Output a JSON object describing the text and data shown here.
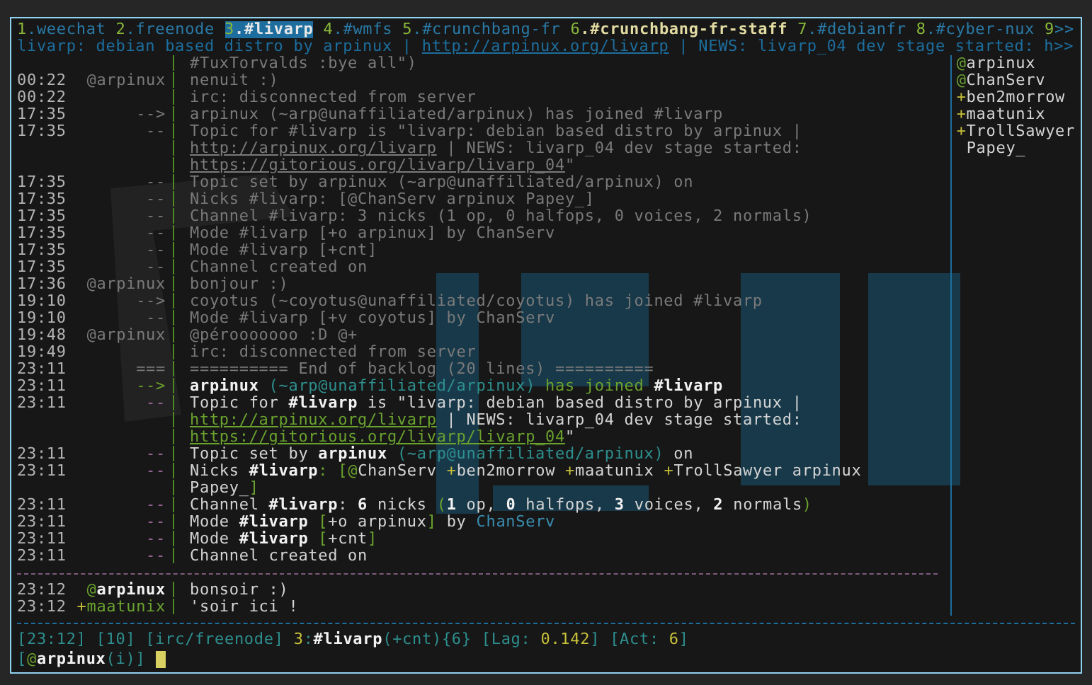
{
  "tabs": [
    {
      "number": "1",
      "name": ".weechat",
      "selected": false,
      "highlight": false
    },
    {
      "number": "2",
      "name": ".freenode",
      "selected": false,
      "highlight": false
    },
    {
      "number": "3",
      "name": ".#livarp",
      "selected": true,
      "highlight": false
    },
    {
      "number": "4",
      "name": ".#wmfs",
      "selected": false,
      "highlight": false
    },
    {
      "number": "5",
      "name": ".#crunchbang-fr",
      "selected": false,
      "highlight": false
    },
    {
      "number": "6",
      "name": ".#crunchbang-fr-staff",
      "selected": false,
      "highlight": true
    },
    {
      "number": "7",
      "name": ".#debianfr",
      "selected": false,
      "highlight": false
    },
    {
      "number": "8",
      "name": ".#cyber-nux",
      "selected": false,
      "highlight": false
    },
    {
      "number": "9",
      "name": ">>",
      "selected": false,
      "highlight": false
    }
  ],
  "title_bar": [
    {
      "text": "livarp: debian based distro by arpinux | ",
      "kind": "text"
    },
    {
      "text": "http://arpinux.org/livarp",
      "kind": "link"
    },
    {
      "text": " | NEWS: livarp_04 dev stage started: h",
      "kind": "text"
    },
    {
      "text": ">>",
      "kind": "more"
    }
  ],
  "lines": [
    {
      "kind": "message",
      "dimmed": true,
      "message": [
        {
          "text": "#TuxTorvalds :bye all\")",
          "kind": "text"
        }
      ]
    },
    {
      "kind": "message",
      "dimmed": true,
      "time": "00:22",
      "prefix": [
        {
          "text": "@arpinux",
          "kind": "text"
        }
      ],
      "message": [
        {
          "text": "nenuit :)",
          "kind": "text"
        }
      ]
    },
    {
      "kind": "message",
      "dimmed": true,
      "time": "00:22",
      "message": [
        {
          "text": "irc: disconnected from server",
          "kind": "text"
        }
      ]
    },
    {
      "kind": "message",
      "dimmed": true,
      "time": "17:35",
      "prefix": [
        {
          "text": "-->",
          "kind": "text"
        }
      ],
      "message": [
        {
          "text": "arpinux (~arp@unaffiliated/arpinux) has joined #livarp",
          "kind": "text"
        }
      ]
    },
    {
      "kind": "message",
      "dimmed": true,
      "time": "17:35",
      "prefix": [
        {
          "text": "--",
          "kind": "text"
        }
      ],
      "message": [
        {
          "text": "Topic for #livarp is \"livarp: debian based distro by arpinux |",
          "kind": "text"
        }
      ]
    },
    {
      "kind": "message",
      "dimmed": true,
      "message": [
        {
          "text": "http://arpinux.org/livarp",
          "kind": "link"
        },
        {
          "text": " | NEWS: livarp_04 dev stage started:",
          "kind": "text"
        }
      ]
    },
    {
      "kind": "message",
      "dimmed": true,
      "message": [
        {
          "text": "https://gitorious.org/livarp/livarp_04",
          "kind": "link"
        },
        {
          "text": "\"",
          "kind": "text"
        }
      ]
    },
    {
      "kind": "message",
      "dimmed": true,
      "time": "17:35",
      "prefix": [
        {
          "text": "--",
          "kind": "text"
        }
      ],
      "message": [
        {
          "text": "Topic set by arpinux (~arp@unaffiliated/arpinux) on",
          "kind": "text"
        }
      ]
    },
    {
      "kind": "message",
      "dimmed": true,
      "time": "17:35",
      "prefix": [
        {
          "text": "--",
          "kind": "text"
        }
      ],
      "message": [
        {
          "text": "Nicks #livarp: [@ChanServ arpinux Papey_]",
          "kind": "text"
        }
      ]
    },
    {
      "kind": "message",
      "dimmed": true,
      "time": "17:35",
      "prefix": [
        {
          "text": "--",
          "kind": "text"
        }
      ],
      "message": [
        {
          "text": "Channel #livarp: 3 nicks (1 op, 0 halfops, 0 voices, 2 normals)",
          "kind": "text"
        }
      ]
    },
    {
      "kind": "message",
      "dimmed": true,
      "time": "17:35",
      "prefix": [
        {
          "text": "--",
          "kind": "text"
        }
      ],
      "message": [
        {
          "text": "Mode #livarp [+o arpinux] by ChanServ",
          "kind": "text"
        }
      ]
    },
    {
      "kind": "message",
      "dimmed": true,
      "time": "17:35",
      "prefix": [
        {
          "text": "--",
          "kind": "text"
        }
      ],
      "message": [
        {
          "text": "Mode #livarp [+cnt]",
          "kind": "text"
        }
      ]
    },
    {
      "kind": "message",
      "dimmed": true,
      "time": "17:35",
      "prefix": [
        {
          "text": "--",
          "kind": "text"
        }
      ],
      "message": [
        {
          "text": "Channel created on",
          "kind": "text"
        }
      ]
    },
    {
      "kind": "message",
      "dimmed": true,
      "time": "17:36",
      "prefix": [
        {
          "text": "@arpinux",
          "kind": "text"
        }
      ],
      "message": [
        {
          "text": "bonjour :)",
          "kind": "text"
        }
      ]
    },
    {
      "kind": "message",
      "dimmed": true,
      "time": "19:10",
      "prefix": [
        {
          "text": "-->",
          "kind": "text"
        }
      ],
      "message": [
        {
          "text": "coyotus (~coyotus@unaffiliated/coyotus) has joined #livarp",
          "kind": "text"
        }
      ]
    },
    {
      "kind": "message",
      "dimmed": true,
      "time": "19:10",
      "prefix": [
        {
          "text": "--",
          "kind": "text"
        }
      ],
      "message": [
        {
          "text": "Mode #livarp [+v coyotus] by ChanServ",
          "kind": "text"
        }
      ]
    },
    {
      "kind": "message",
      "dimmed": true,
      "time": "19:48",
      "prefix": [
        {
          "text": "@arpinux",
          "kind": "text"
        }
      ],
      "message": [
        {
          "text": "@pérooooooo :D @+",
          "kind": "text"
        }
      ]
    },
    {
      "kind": "message",
      "dimmed": true,
      "time": "19:49",
      "message": [
        {
          "text": "irc: disconnected from server",
          "kind": "text"
        }
      ]
    },
    {
      "kind": "message",
      "dimmed": true,
      "time": "23:11",
      "prefix": [
        {
          "text": "===",
          "kind": "text"
        }
      ],
      "message": [
        {
          "text": "========== End of backlog (20 lines) ==========",
          "kind": "text"
        }
      ]
    },
    {
      "kind": "message",
      "dimmed": false,
      "time": "23:11",
      "prefix": [
        {
          "text": "-->",
          "kind": "green"
        }
      ],
      "message": [
        {
          "text": "arpinux",
          "kind": "bold"
        },
        {
          "text": " (~arp@unaffiliated/arpinux)",
          "kind": "host"
        },
        {
          "text": " has joined ",
          "kind": "green"
        },
        {
          "text": "#livarp",
          "kind": "bold"
        }
      ]
    },
    {
      "kind": "message",
      "dimmed": false,
      "time": "23:11",
      "prefix": [
        {
          "text": "--",
          "kind": "network"
        }
      ],
      "message": [
        {
          "text": "Topic for ",
          "kind": "text"
        },
        {
          "text": "#livarp",
          "kind": "bold"
        },
        {
          "text": " is \"livarp: debian based distro by arpinux |",
          "kind": "text"
        }
      ]
    },
    {
      "kind": "message",
      "dimmed": false,
      "message": [
        {
          "text": "http://arpinux.org/livarp",
          "kind": "link"
        },
        {
          "text": " | NEWS: livarp_04 dev stage started:",
          "kind": "text"
        }
      ]
    },
    {
      "kind": "message",
      "dimmed": false,
      "message": [
        {
          "text": "https://gitorious.org/livarp/livarp_04",
          "kind": "link"
        },
        {
          "text": "\"",
          "kind": "text"
        }
      ]
    },
    {
      "kind": "message",
      "dimmed": false,
      "time": "23:11",
      "prefix": [
        {
          "text": "--",
          "kind": "network"
        }
      ],
      "message": [
        {
          "text": "Topic set by ",
          "kind": "text"
        },
        {
          "text": "arpinux",
          "kind": "bold"
        },
        {
          "text": " (~arp@unaffiliated/arpinux)",
          "kind": "host"
        },
        {
          "text": " on",
          "kind": "text"
        }
      ]
    },
    {
      "kind": "message",
      "dimmed": false,
      "time": "23:11",
      "prefix": [
        {
          "text": "--",
          "kind": "network"
        }
      ],
      "message": [
        {
          "text": "Nicks ",
          "kind": "text"
        },
        {
          "text": "#livarp",
          "kind": "bold"
        },
        {
          "text": ": [",
          "kind": "green"
        },
        {
          "text": "@",
          "kind": "green"
        },
        {
          "text": "ChanServ ",
          "kind": "text"
        },
        {
          "text": "+",
          "kind": "voice"
        },
        {
          "text": "ben2morrow ",
          "kind": "text"
        },
        {
          "text": "+",
          "kind": "voice"
        },
        {
          "text": "maatunix ",
          "kind": "text"
        },
        {
          "text": "+",
          "kind": "voice"
        },
        {
          "text": "TrollSawyer arpinux",
          "kind": "text"
        }
      ]
    },
    {
      "kind": "message",
      "dimmed": false,
      "message": [
        {
          "text": "Papey_",
          "kind": "text"
        },
        {
          "text": "]",
          "kind": "green"
        }
      ]
    },
    {
      "kind": "message",
      "dimmed": false,
      "time": "23:11",
      "prefix": [
        {
          "text": "--",
          "kind": "network"
        }
      ],
      "message": [
        {
          "text": "Channel ",
          "kind": "text"
        },
        {
          "text": "#livarp",
          "kind": "bold"
        },
        {
          "text": ": ",
          "kind": "text"
        },
        {
          "text": "6",
          "kind": "bold"
        },
        {
          "text": " nicks ",
          "kind": "text"
        },
        {
          "text": "(",
          "kind": "green"
        },
        {
          "text": "1",
          "kind": "bold"
        },
        {
          "text": " op, ",
          "kind": "text"
        },
        {
          "text": "0",
          "kind": "bold"
        },
        {
          "text": " halfops, ",
          "kind": "text"
        },
        {
          "text": "3",
          "kind": "bold"
        },
        {
          "text": " voices, ",
          "kind": "text"
        },
        {
          "text": "2",
          "kind": "bold"
        },
        {
          "text": " normals",
          "kind": "text"
        },
        {
          "text": ")",
          "kind": "green"
        }
      ]
    },
    {
      "kind": "message",
      "dimmed": false,
      "time": "23:11",
      "prefix": [
        {
          "text": "--",
          "kind": "network"
        }
      ],
      "message": [
        {
          "text": "Mode ",
          "kind": "text"
        },
        {
          "text": "#livarp",
          "kind": "bold"
        },
        {
          "text": " [",
          "kind": "green"
        },
        {
          "text": "+o arpinux",
          "kind": "text"
        },
        {
          "text": "]",
          "kind": "green"
        },
        {
          "text": " by ",
          "kind": "text"
        },
        {
          "text": "ChanServ",
          "kind": "nick"
        }
      ]
    },
    {
      "kind": "message",
      "dimmed": false,
      "time": "23:11",
      "prefix": [
        {
          "text": "--",
          "kind": "network"
        }
      ],
      "message": [
        {
          "text": "Mode ",
          "kind": "text"
        },
        {
          "text": "#livarp",
          "kind": "bold"
        },
        {
          "text": " [",
          "kind": "green"
        },
        {
          "text": "+cnt",
          "kind": "text"
        },
        {
          "text": "]",
          "kind": "green"
        }
      ]
    },
    {
      "kind": "message",
      "dimmed": false,
      "time": "23:11",
      "prefix": [
        {
          "text": "--",
          "kind": "network"
        }
      ],
      "message": [
        {
          "text": "Channel created on",
          "kind": "text"
        }
      ]
    },
    {
      "kind": "read_marker"
    },
    {
      "kind": "message",
      "dimmed": false,
      "time": "23:12",
      "prefix": [
        {
          "text": "@",
          "kind": "green"
        },
        {
          "text": "arpinux",
          "kind": "bold"
        }
      ],
      "message": [
        {
          "text": "bonsoir :)",
          "kind": "text"
        }
      ]
    },
    {
      "kind": "message",
      "dimmed": false,
      "time": "23:12",
      "prefix": [
        {
          "text": "+",
          "kind": "voice"
        },
        {
          "text": "maatunix",
          "kind": "green"
        }
      ],
      "message": [
        {
          "text": "'soir ici !",
          "kind": "text"
        }
      ]
    }
  ],
  "nicklist": [
    {
      "mode": "@",
      "name": "arpinux"
    },
    {
      "mode": "@",
      "name": "ChanServ"
    },
    {
      "mode": "+",
      "name": "ben2morrow"
    },
    {
      "mode": "+",
      "name": "maatunix"
    },
    {
      "mode": "+",
      "name": "TrollSawyer"
    },
    {
      "name": "Papey_"
    }
  ],
  "status_bar": [
    [
      {
        "text": "[23:12]",
        "kind": "delim"
      }
    ],
    [
      {
        "text": "[10]",
        "kind": "delim"
      }
    ],
    [
      {
        "text": "[irc/freenode]",
        "kind": "delim"
      }
    ],
    [
      {
        "text": "3",
        "kind": "value"
      },
      {
        "text": ":",
        "kind": "delim"
      },
      {
        "text": "#livarp",
        "kind": "bold"
      },
      {
        "text": "(+cnt){6}",
        "kind": "delim"
      }
    ],
    [
      {
        "text": "[Lag: ",
        "kind": "delim"
      },
      {
        "text": "0.142",
        "kind": "value"
      },
      {
        "text": "]",
        "kind": "delim"
      }
    ],
    [
      {
        "text": "[Act: ",
        "kind": "delim"
      },
      {
        "text": "6",
        "kind": "value"
      },
      {
        "text": "]",
        "kind": "delim"
      }
    ]
  ],
  "input_prompt": [
    {
      "text": "[",
      "kind": "delim"
    },
    {
      "text": "@",
      "kind": "green"
    },
    {
      "text": "arpinux",
      "kind": "bold"
    },
    {
      "text": "(i)]",
      "kind": "delim"
    }
  ]
}
